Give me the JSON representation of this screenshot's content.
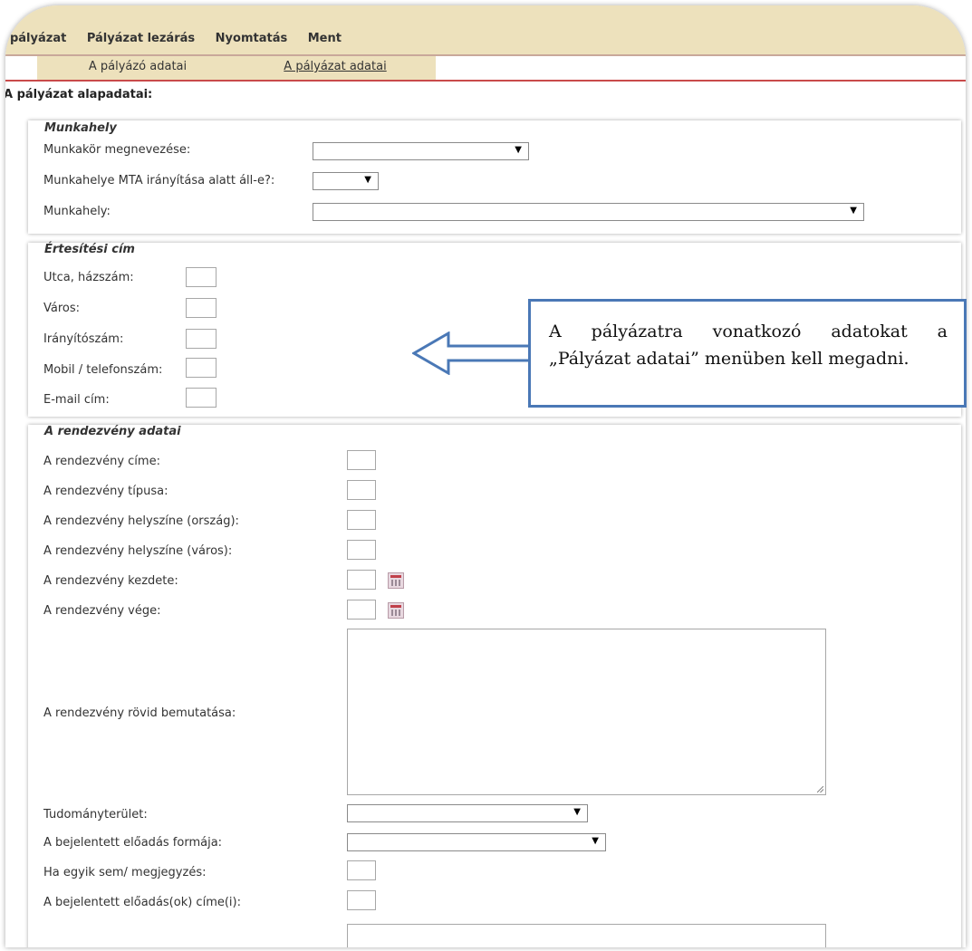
{
  "menu": [
    "j pályázat",
    "Pályázat lezárás",
    "Nyomtatás",
    "Ment"
  ],
  "tabs": [
    "A pályázó adatai",
    "A pályázat adatai"
  ],
  "section_title": "A pályázat alapadatai:",
  "munkahely": {
    "legend": "Munkahely",
    "labels": [
      "Munkakör megnevezése:",
      "Munkahelye MTA irányítása alatt áll-e?:",
      "Munkahely:"
    ]
  },
  "ertesitesi": {
    "legend": "Értesítési cím",
    "labels": [
      "Utca, házszám:",
      "Város:",
      "Irányítószám:",
      "Mobil / telefonszám:",
      "E-mail cím:"
    ]
  },
  "rendezveny": {
    "legend": "A rendezvény adatai",
    "labels": [
      "A rendezvény címe:",
      "A rendezvény típusa:",
      "A rendezvény helyszíne (ország):",
      "A rendezvény helyszíne (város):",
      "A rendezvény kezdete:",
      "A rendezvény vége:",
      "A rendezvény rövid bemutatása:",
      "Tudományterület:",
      "A bejelentett előadás formája:",
      "Ha egyik sem/ megjegyzés:",
      "A bejelentett előadás(ok) címe(i):"
    ]
  },
  "callout": {
    "line1_words": [
      "A",
      "pályázatra",
      "vonatkozó",
      "adatokat",
      "a"
    ],
    "line2": "„Pályázat adatai” menüben kell megadni."
  },
  "dropdown_arrow": "▼"
}
